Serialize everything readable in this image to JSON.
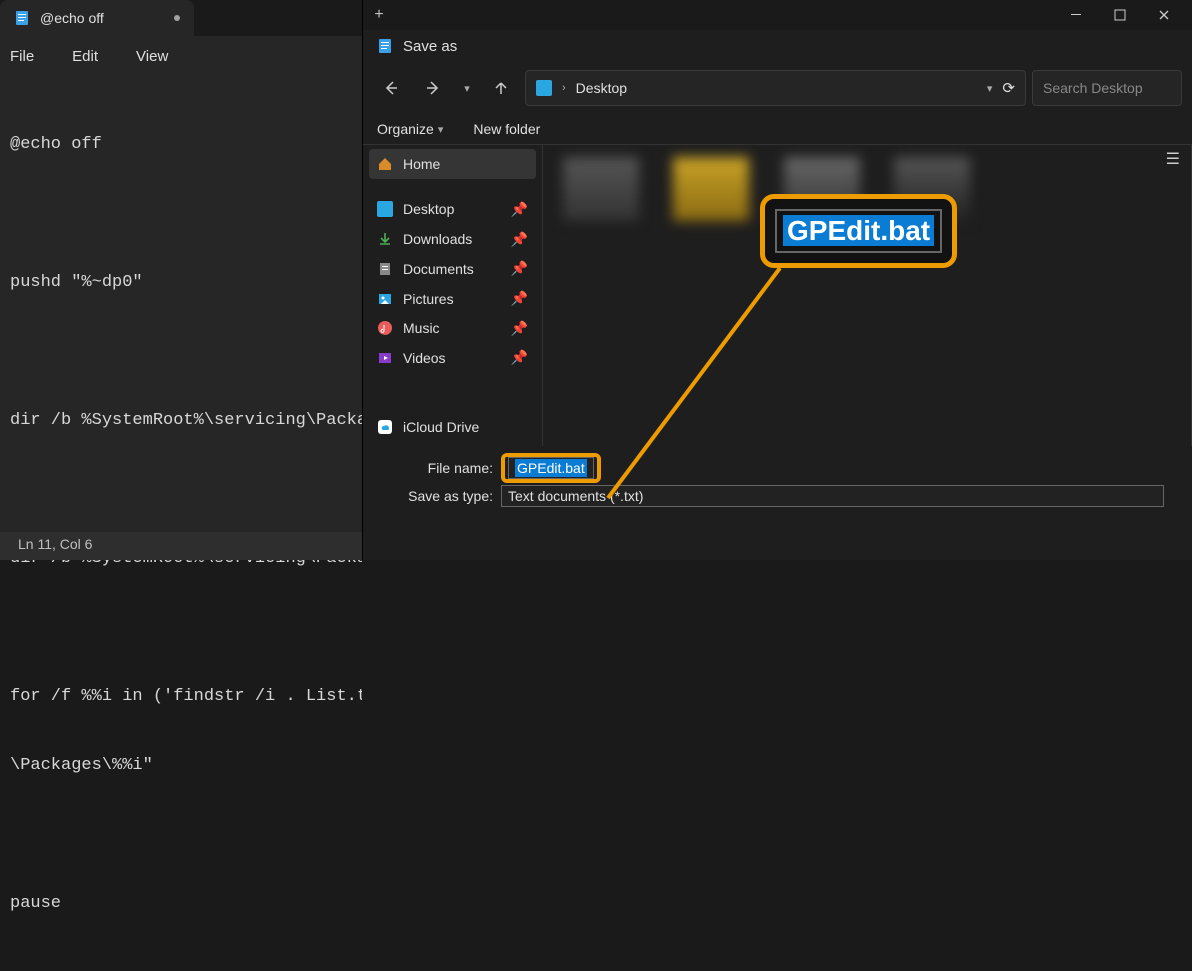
{
  "notepad": {
    "tab_title": "@echo off",
    "menu": {
      "file": "File",
      "edit": "Edit",
      "view": "View"
    },
    "lines": [
      "@echo off",
      "",
      "pushd \"%~dp0\"",
      "",
      "dir /b %SystemRoot%\\servicing\\Packa",
      "",
      "dir /b %SystemRoot%\\servicing\\Packa",
      "",
      "for /f %%i in ('findstr /i . List.t",
      "\\Packages\\%%i\"",
      "",
      "pause"
    ],
    "status": "Ln 11, Col 6"
  },
  "dialog": {
    "title": "Save as",
    "breadcrumb": "Desktop",
    "search_placeholder": "Search Desktop",
    "organize": "Organize",
    "newfolder": "New folder",
    "sidebar": {
      "home": "Home",
      "desktop": "Desktop",
      "downloads": "Downloads",
      "documents": "Documents",
      "pictures": "Pictures",
      "music": "Music",
      "videos": "Videos",
      "icloud": "iCloud Drive"
    },
    "filename_label": "File name:",
    "filename_value": "GPEdit.bat",
    "savetype_label": "Save as type:",
    "savetype_value": "Text documents (*.txt)"
  },
  "callout": {
    "text": "GPEdit.bat"
  }
}
